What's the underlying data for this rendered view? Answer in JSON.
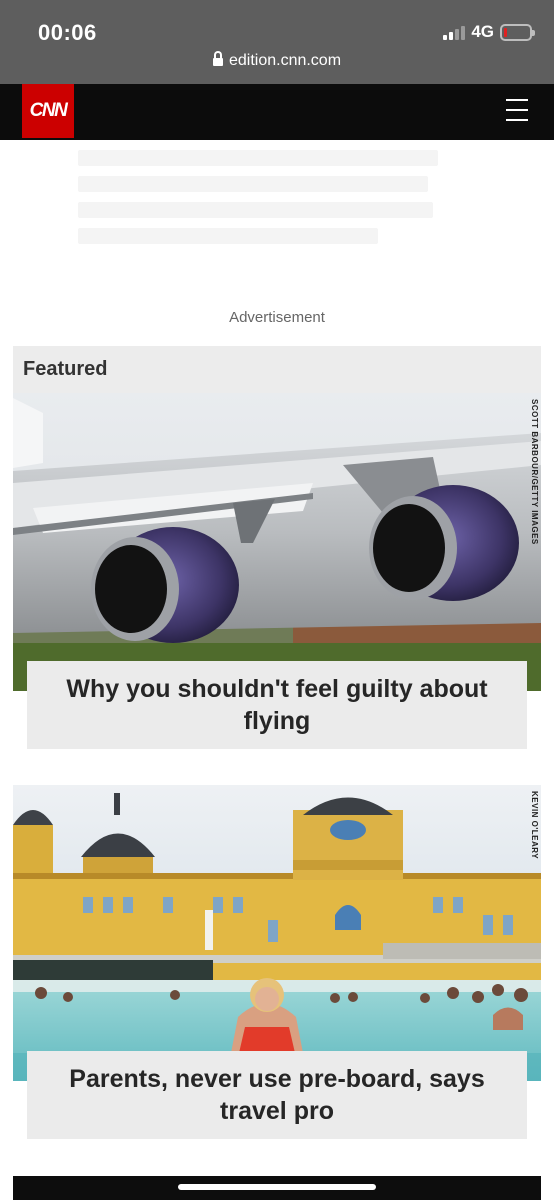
{
  "status_bar": {
    "time": "00:06",
    "network": "4G",
    "url": "edition.cnn.com"
  },
  "header": {
    "logo_text": "CNN",
    "menu_icon": "hamburger-menu-icon"
  },
  "advertisement_label": "Advertisement",
  "featured": {
    "title": "Featured",
    "cards": [
      {
        "headline": "Why you shouldn't feel guilty about flying",
        "credit": "SCOTT BARBOUR/GETTY IMAGES"
      },
      {
        "headline": "Parents, never use pre-board, says travel pro",
        "credit": "KEVIN O'LEARY"
      }
    ]
  },
  "colors": {
    "status_bar_bg": "#5e5e5e",
    "header_bg": "#0c0c0c",
    "cnn_red": "#cc0000",
    "featured_bg": "#ececec"
  }
}
